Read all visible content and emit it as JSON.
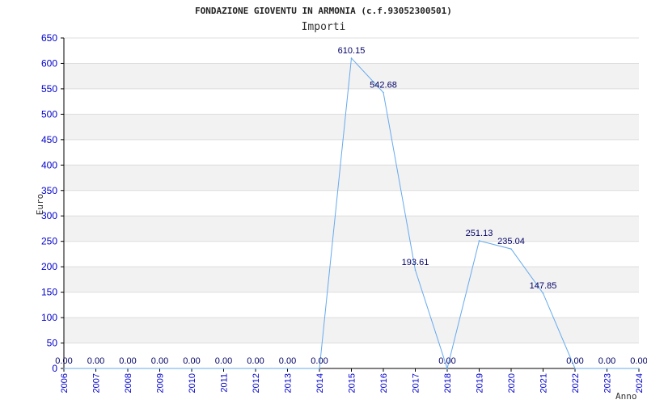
{
  "chart_data": {
    "type": "line",
    "title": "FONDAZIONE GIOVENTU IN ARMONIA (c.f.93052300501)",
    "subtitle": "Importi",
    "xlabel": "Anno",
    "ylabel": "Euro",
    "x": [
      "2006",
      "2007",
      "2008",
      "2009",
      "2010",
      "2011",
      "2012",
      "2013",
      "2014",
      "2015",
      "2016",
      "2017",
      "2018",
      "2019",
      "2020",
      "2021",
      "2022",
      "2023",
      "2024"
    ],
    "series": [
      {
        "values": [
          0,
          0,
          0,
          0,
          0,
          0,
          0,
          0,
          0,
          610.15,
          542.68,
          193.61,
          0,
          251.13,
          235.04,
          147.85,
          0,
          0,
          0
        ],
        "labels": [
          "0.00",
          "0.00",
          "0.00",
          "0.00",
          "0.00",
          "0.00",
          "0.00",
          "0.00",
          "0.00",
          "610.15",
          "542.68",
          "193.61",
          "0.00",
          "251.13",
          "235.04",
          "147.85",
          "0.00",
          "0.00",
          "0.00"
        ],
        "color": "#66aaee"
      }
    ],
    "yticks": [
      "0",
      "50",
      "100",
      "150",
      "200",
      "250",
      "300",
      "350",
      "400",
      "450",
      "500",
      "550",
      "600",
      "650"
    ],
    "ylim": [
      0,
      650
    ],
    "grid": true,
    "band_colors": [
      "#ffffff",
      "#f2f2f2"
    ],
    "gridline_color": "#dddddd",
    "tick_color": "#0000cc",
    "label_color": "#000066"
  }
}
